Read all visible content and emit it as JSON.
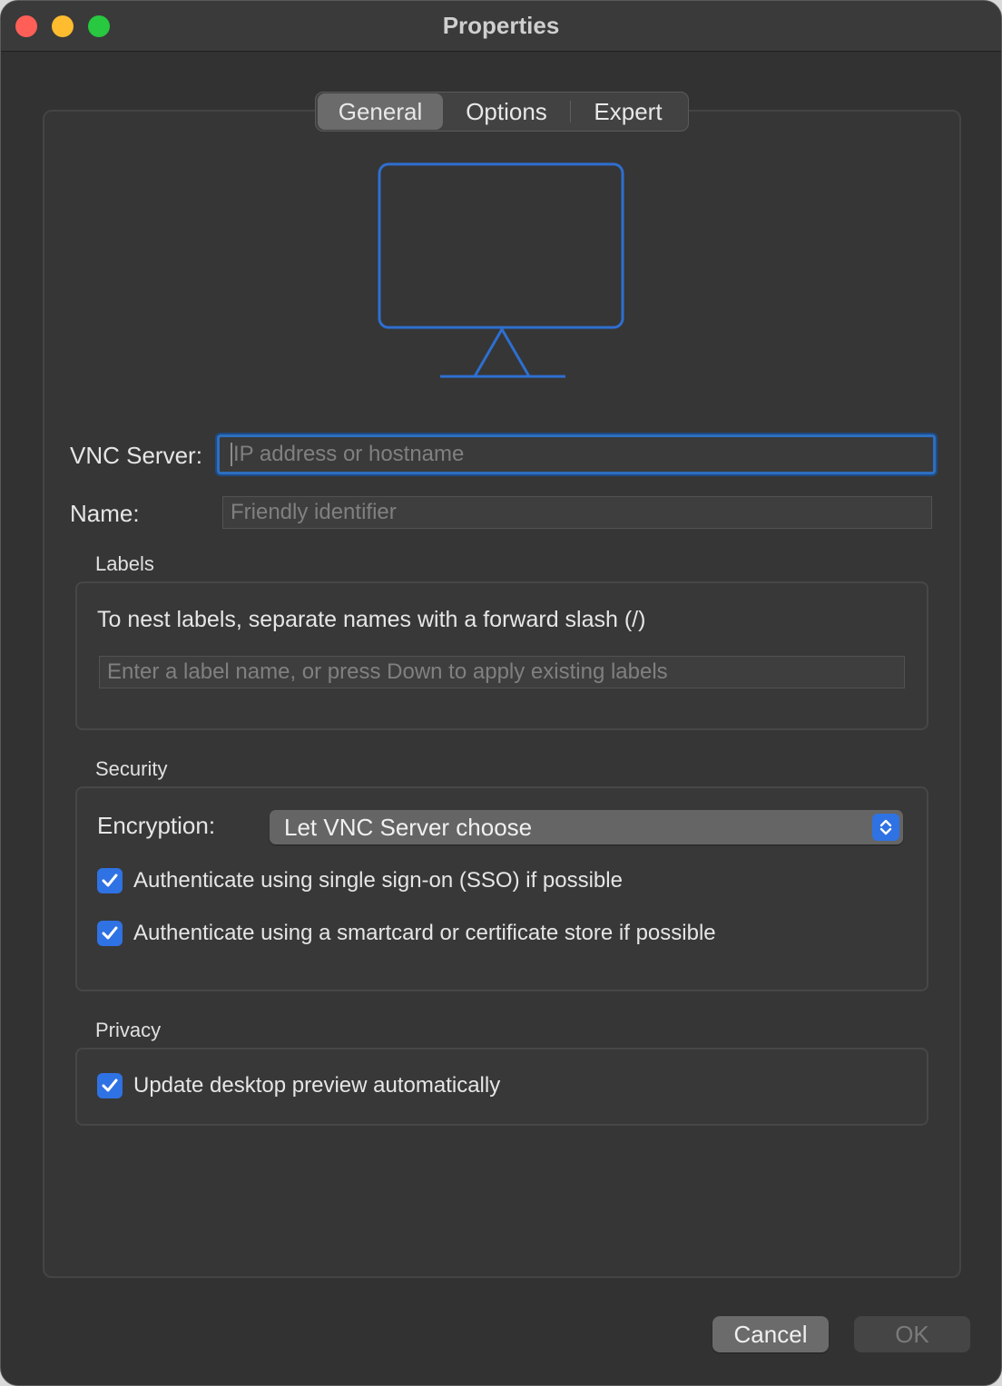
{
  "window": {
    "title": "Properties"
  },
  "tabs": [
    {
      "label": "General",
      "active": true
    },
    {
      "label": "Options",
      "active": false
    },
    {
      "label": "Expert",
      "active": false
    }
  ],
  "icon": {
    "name": "monitor-icon",
    "color": "#2e6fd0"
  },
  "form": {
    "vnc_server_label": "VNC Server:",
    "vnc_server_placeholder": "IP address or hostname",
    "vnc_server_value": "",
    "name_label": "Name:",
    "name_placeholder": "Friendly identifier",
    "name_value": ""
  },
  "labels_section": {
    "title": "Labels",
    "hint": "To nest labels, separate names with a forward slash (/)",
    "input_placeholder": "Enter a label name, or press Down to apply existing labels"
  },
  "security_section": {
    "title": "Security",
    "encryption_label": "Encryption:",
    "encryption_value": "Let VNC Server choose",
    "sso_label": "Authenticate using single sign-on (SSO) if possible",
    "sso_checked": true,
    "smartcard_label": "Authenticate using a smartcard or certificate store if possible",
    "smartcard_checked": true
  },
  "privacy_section": {
    "title": "Privacy",
    "preview_label": "Update desktop preview automatically",
    "preview_checked": true
  },
  "buttons": {
    "cancel": "Cancel",
    "ok": "OK"
  },
  "colors": {
    "accent": "#2f72e3",
    "window_bg": "#323232"
  }
}
